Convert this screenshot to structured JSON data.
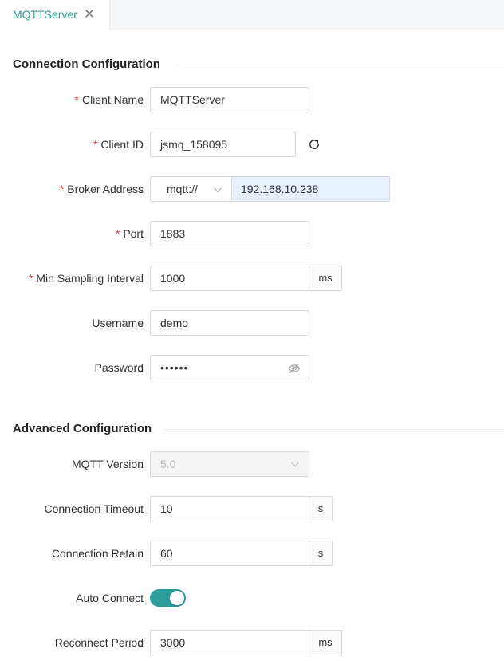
{
  "tab": {
    "title": "MQTTServer"
  },
  "connection": {
    "title": "Connection Configuration",
    "client_name": {
      "label": "Client Name",
      "value": "MQTTServer"
    },
    "client_id": {
      "label": "Client ID",
      "value": "jsmq_158095"
    },
    "broker": {
      "label": "Broker Address",
      "protocol": "mqtt://",
      "host": "192.168.10.238"
    },
    "port": {
      "label": "Port",
      "value": "1883"
    },
    "min_sampling": {
      "label": "Min Sampling Interval",
      "value": "1000",
      "unit": "ms"
    },
    "username": {
      "label": "Username",
      "value": "demo"
    },
    "password": {
      "label": "Password",
      "value": "••••••"
    }
  },
  "advanced": {
    "title": "Advanced Configuration",
    "mqtt_version": {
      "label": "MQTT Version",
      "value": "5.0"
    },
    "connection_timeout": {
      "label": "Connection Timeout",
      "value": "10",
      "unit": "s"
    },
    "connection_retain": {
      "label": "Connection Retain",
      "value": "60",
      "unit": "s"
    },
    "auto_connect": {
      "label": "Auto Connect",
      "enabled": true
    },
    "reconnect_period": {
      "label": "Reconnect Period",
      "value": "3000",
      "unit": "ms"
    }
  },
  "colors": {
    "accent": "#2b9c9b",
    "required": "#e4393c",
    "autofill": "#e8f0fe"
  },
  "colon": ":"
}
